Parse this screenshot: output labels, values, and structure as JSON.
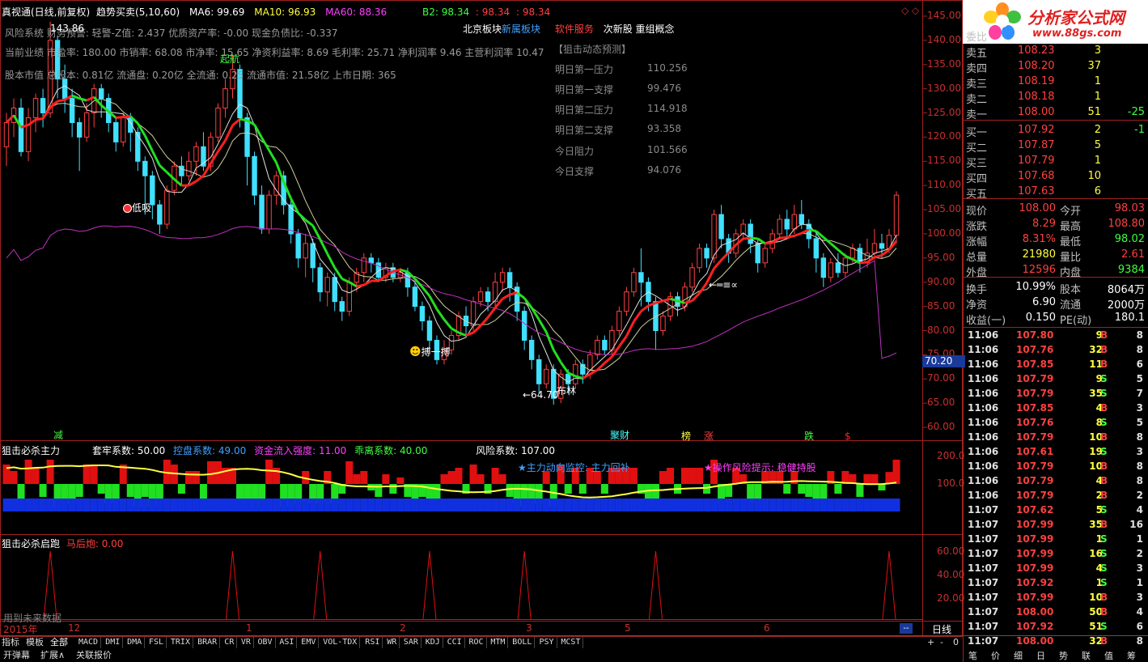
{
  "header": {
    "title": "真视通(日线,前复权)",
    "indicator": "趋势买卖(5,10,60)",
    "ma6_label": "MA6: 99.69",
    "ma10_label": "MA10: 96.93",
    "ma60_label": "MA60: 88.36",
    "b2_label": "B2: 98.34",
    "b2_v2": ": 98.34",
    "b2_v3": ": 98.34",
    "window_icons": "◇ ◇"
  },
  "info_lines": [
    "风险系统 财务预警: 轻警-Z值: 2.437 优质资产率: -0.00 现金负债比: -0.337",
    "当前业绩 市盈率: 180.00 市销率: 68.08 市净率: 15.65 净资利益率: 8.69 毛利率: 25.71 净利润率 9.46 主营利润率 10.47",
    "股本市值 总股本: 0.81亿 流通盘: 0.20亿 全流通: 0.25 流通市值: 21.58亿 上市日期: 365"
  ],
  "concepts": [
    {
      "text": "北京板块",
      "color": "#ffffff"
    },
    {
      "text": "新属板块",
      "color": "#40a0ff"
    },
    {
      "text": "软件服务",
      "color": "#ff4040"
    },
    {
      "text": "次新股",
      "color": "#ffffff"
    },
    {
      "text": "重组概念",
      "color": "#ffffff"
    }
  ],
  "prediction": {
    "title": "【狙击动态预测】",
    "rows": [
      {
        "label": "明日第一压力",
        "value": "110.256"
      },
      {
        "label": "明日第一支撑",
        "value": "99.476"
      },
      {
        "label": "明日第二压力",
        "value": "114.918"
      },
      {
        "label": "明日第二支撑",
        "value": "93.358"
      },
      {
        "label": "今日阻力",
        "value": "101.566"
      },
      {
        "label": "今日支撑",
        "value": "94.076"
      }
    ]
  },
  "main_annotations": {
    "high_mark": "143.86",
    "low_mark": "←64.70",
    "ma_mark": "←═≡∝",
    "qi_hang": "起航",
    "di_xi": "低吸",
    "bo_yi_bo": "搏一搏",
    "bu_lin": "布林",
    "jian": "减",
    "qi_cai": "聚财",
    "bang": "榜",
    "zhang": "涨",
    "die": "跌",
    "dollar": "$",
    "price_box": "70.20"
  },
  "price_axis": [
    "145.00",
    "140.00",
    "135.00",
    "130.00",
    "125.00",
    "120.00",
    "115.00",
    "110.00",
    "105.00",
    "100.00",
    "95.00",
    "90.00",
    "85.00",
    "80.00",
    "75.00",
    "70.00",
    "65.00",
    "60.00"
  ],
  "sub1": {
    "title": "狙击必杀主力",
    "params": [
      {
        "text": "套牢系数: 50.00",
        "color": "#ffffff"
      },
      {
        "text": "控盘系数: 49.00",
        "color": "#40a0ff"
      },
      {
        "text": "资金流入强度: 11.00",
        "color": "#ff40ff"
      },
      {
        "text": "乖离系数: 40.00",
        "color": "#40ff40"
      },
      {
        "text": "风险系数: 107.00",
        "color": "#ffffff"
      }
    ],
    "monitor": "★主力动向监控: 主力回补",
    "risk_tip": "★操作风险提示: 稳健持股",
    "axis": [
      "200.0",
      "100.0"
    ]
  },
  "sub2": {
    "title": "狙击必杀启跑",
    "param": "马后炮: 0.00",
    "note": "用到未来数据",
    "axis": [
      "60.00",
      "40.00",
      "20.00"
    ]
  },
  "date_axis": {
    "year": "2015年",
    "marks": [
      "12",
      "1",
      "2",
      "3",
      "5",
      "6"
    ],
    "period": "日线"
  },
  "quote_panel": {
    "webi": "委比",
    "sells": [
      {
        "label": "卖五",
        "price": "108.23",
        "vol": "3",
        "chg": ""
      },
      {
        "label": "卖四",
        "price": "108.20",
        "vol": "37",
        "chg": ""
      },
      {
        "label": "卖三",
        "price": "108.19",
        "vol": "1",
        "chg": ""
      },
      {
        "label": "卖二",
        "price": "108.18",
        "vol": "1",
        "chg": ""
      },
      {
        "label": "卖一",
        "price": "108.00",
        "vol": "51",
        "chg": "-25"
      }
    ],
    "buys": [
      {
        "label": "买一",
        "price": "107.92",
        "vol": "2",
        "chg": "-1"
      },
      {
        "label": "买二",
        "price": "107.87",
        "vol": "5",
        "chg": ""
      },
      {
        "label": "买三",
        "price": "107.79",
        "vol": "1",
        "chg": ""
      },
      {
        "label": "买四",
        "price": "107.68",
        "vol": "10",
        "chg": ""
      },
      {
        "label": "买五",
        "price": "107.63",
        "vol": "6",
        "chg": ""
      }
    ],
    "stats": [
      {
        "l1": "现价",
        "v1": "108.00",
        "c1": "#ff4040",
        "l2": "今开",
        "v2": "98.03",
        "c2": "#ff4040"
      },
      {
        "l1": "涨跌",
        "v1": "8.29",
        "c1": "#ff4040",
        "l2": "最高",
        "v2": "108.80",
        "c2": "#ff4040"
      },
      {
        "l1": "涨幅",
        "v1": "8.31%",
        "c1": "#ff4040",
        "l2": "最低",
        "v2": "98.02",
        "c2": "#40ff40"
      },
      {
        "l1": "总量",
        "v1": "21980",
        "c1": "#ffff40",
        "l2": "量比",
        "v2": "2.61",
        "c2": "#ff4040"
      },
      {
        "l1": "外盘",
        "v1": "12596",
        "c1": "#ff4040",
        "l2": "内盘",
        "v2": "9384",
        "c2": "#40ff40"
      }
    ],
    "stats2": [
      {
        "l1": "换手",
        "v1": "10.99%",
        "l2": "股本",
        "v2": "8064万"
      },
      {
        "l1": "净资",
        "v1": "6.90",
        "l2": "流通",
        "v2": "2000万"
      },
      {
        "l1": "收益(一)",
        "v1": "0.150",
        "l2": "PE(动)",
        "v2": "180.1"
      }
    ],
    "ticks": [
      {
        "t": "11:06",
        "p": "107.80",
        "v": "9",
        "s": "B",
        "n": "8"
      },
      {
        "t": "11:06",
        "p": "107.76",
        "v": "32",
        "s": "B",
        "n": "8"
      },
      {
        "t": "11:06",
        "p": "107.85",
        "v": "11",
        "s": "B",
        "n": "6"
      },
      {
        "t": "11:06",
        "p": "107.79",
        "v": "9",
        "s": "S",
        "n": "5"
      },
      {
        "t": "11:06",
        "p": "107.79",
        "v": "35",
        "s": "S",
        "n": "7"
      },
      {
        "t": "11:06",
        "p": "107.85",
        "v": "4",
        "s": "B",
        "n": "3"
      },
      {
        "t": "11:06",
        "p": "107.76",
        "v": "8",
        "s": "S",
        "n": "5"
      },
      {
        "t": "11:06",
        "p": "107.79",
        "v": "10",
        "s": "B",
        "n": "8"
      },
      {
        "t": "11:06",
        "p": "107.61",
        "v": "19",
        "s": "S",
        "n": "3"
      },
      {
        "t": "11:06",
        "p": "107.79",
        "v": "10",
        "s": "B",
        "n": "8"
      },
      {
        "t": "11:06",
        "p": "107.79",
        "v": "4",
        "s": "B",
        "n": "8"
      },
      {
        "t": "11:06",
        "p": "107.79",
        "v": "2",
        "s": "B",
        "n": "2"
      },
      {
        "t": "11:07",
        "p": "107.62",
        "v": "5",
        "s": "S",
        "n": "4"
      },
      {
        "t": "11:07",
        "p": "107.99",
        "v": "35",
        "s": "B",
        "n": "16"
      },
      {
        "t": "11:07",
        "p": "107.99",
        "v": "1",
        "s": "S",
        "n": "1"
      },
      {
        "t": "11:07",
        "p": "107.99",
        "v": "16",
        "s": "S",
        "n": "2"
      },
      {
        "t": "11:07",
        "p": "107.99",
        "v": "4",
        "s": "S",
        "n": "3"
      },
      {
        "t": "11:07",
        "p": "107.92",
        "v": "1",
        "s": "S",
        "n": "1"
      },
      {
        "t": "11:07",
        "p": "107.99",
        "v": "10",
        "s": "B",
        "n": "3"
      },
      {
        "t": "11:07",
        "p": "108.00",
        "v": "50",
        "s": "B",
        "n": "4"
      },
      {
        "t": "11:07",
        "p": "107.92",
        "v": "51",
        "s": "S",
        "n": "6"
      },
      {
        "t": "11:07",
        "p": "108.00",
        "v": "32",
        "s": "B",
        "n": "8"
      }
    ]
  },
  "logo": {
    "text": "分析家公式网",
    "url": "www.88gs.com"
  },
  "bottom_tabs": {
    "left": [
      "指标",
      "模板",
      "全部"
    ],
    "indicators": [
      "MACD",
      "DMI",
      "DMA",
      "FSL",
      "TRIX",
      "BRAR",
      "CR",
      "VR",
      "OBV",
      "ASI",
      "EMV",
      "VOL-TDX",
      "RSI",
      "WR",
      "SAR",
      "KDJ",
      "CCI",
      "ROC",
      "MTM",
      "BOLL",
      "PSY",
      "MCST"
    ],
    "ctrl": [
      "+",
      "-",
      "0"
    ],
    "row2": [
      "开弹幕",
      "扩展∧",
      "关联报价"
    ],
    "right": [
      "笔",
      "价",
      "细",
      "日",
      "势",
      "联",
      "值",
      "筹"
    ]
  },
  "colors": {
    "up": "#ff4040",
    "down": "#40e0ff",
    "ma_up": "#ff2020",
    "ma_down": "#20e020",
    "ma60": "#c030c0"
  },
  "chart_data": {
    "type": "candlestick",
    "ylim": [
      58,
      146
    ],
    "candles": [
      [
        118,
        123,
        114,
        125
      ],
      [
        123,
        126,
        120,
        128
      ],
      [
        126,
        117,
        116,
        128
      ],
      [
        117,
        124,
        115,
        126
      ],
      [
        124,
        128,
        121,
        129
      ],
      [
        128,
        125,
        122,
        130
      ],
      [
        125,
        140,
        124,
        143.86
      ],
      [
        140,
        132,
        128,
        141
      ],
      [
        132,
        128,
        125,
        135
      ],
      [
        128,
        123,
        120,
        130
      ],
      [
        123,
        120,
        113,
        124
      ],
      [
        120,
        125,
        119,
        127
      ],
      [
        125,
        130,
        122,
        131
      ],
      [
        130,
        128,
        124,
        131
      ],
      [
        128,
        123,
        121,
        129
      ],
      [
        123,
        119,
        117,
        124
      ],
      [
        119,
        124,
        118,
        125
      ],
      [
        124,
        121,
        117,
        125
      ],
      [
        121,
        115,
        113,
        122
      ],
      [
        115,
        112,
        104,
        116
      ],
      [
        112,
        106,
        103,
        113
      ],
      [
        106,
        102,
        100,
        107
      ],
      [
        102,
        109,
        101,
        110
      ],
      [
        109,
        114,
        108,
        115
      ],
      [
        114,
        112,
        110,
        116
      ],
      [
        112,
        115,
        111,
        117
      ],
      [
        115,
        118,
        112,
        119
      ],
      [
        118,
        114,
        113,
        121
      ],
      [
        114,
        120,
        113,
        121
      ],
      [
        120,
        126,
        119,
        127
      ],
      [
        126,
        130,
        124,
        132
      ],
      [
        130,
        134,
        128,
        137
      ],
      [
        134,
        124,
        122,
        135
      ],
      [
        124,
        116,
        110,
        125
      ],
      [
        116,
        108,
        106,
        117
      ],
      [
        108,
        101,
        100,
        110
      ],
      [
        101,
        108,
        100,
        109
      ],
      [
        108,
        112,
        106,
        113
      ],
      [
        112,
        106,
        104,
        113
      ],
      [
        106,
        100,
        98,
        107
      ],
      [
        100,
        95,
        93,
        101
      ],
      [
        95,
        98,
        91,
        100
      ],
      [
        98,
        93,
        90,
        99
      ],
      [
        93,
        88,
        86,
        94
      ],
      [
        88,
        91,
        85,
        92
      ],
      [
        91,
        86,
        84,
        92
      ],
      [
        86,
        84,
        82,
        87
      ],
      [
        84,
        90,
        83,
        91
      ],
      [
        90,
        92,
        88,
        93
      ],
      [
        92,
        95,
        90,
        96
      ],
      [
        95,
        94,
        92,
        96
      ],
      [
        94,
        91,
        90,
        95
      ],
      [
        91,
        93,
        90,
        94
      ],
      [
        93,
        91,
        90,
        94
      ],
      [
        91,
        92,
        90,
        93
      ],
      [
        92,
        89,
        87,
        93
      ],
      [
        89,
        85,
        84,
        90
      ],
      [
        85,
        82,
        80,
        86
      ],
      [
        82,
        78,
        76,
        83
      ],
      [
        78,
        74,
        73,
        79
      ],
      [
        74,
        76,
        73,
        78
      ],
      [
        76,
        79,
        75,
        80
      ],
      [
        79,
        83,
        78,
        84
      ],
      [
        83,
        81,
        79,
        85
      ],
      [
        81,
        86,
        80,
        87
      ],
      [
        86,
        88,
        85,
        89
      ],
      [
        88,
        86,
        84,
        89
      ],
      [
        86,
        90,
        85,
        92
      ],
      [
        90,
        92,
        88,
        93
      ],
      [
        92,
        89,
        86,
        93
      ],
      [
        89,
        84,
        82,
        90
      ],
      [
        84,
        78,
        76,
        85
      ],
      [
        78,
        74,
        72,
        79
      ],
      [
        74,
        69,
        67,
        75
      ],
      [
        69,
        72,
        68,
        73
      ],
      [
        72,
        66,
        64.7,
        73
      ],
      [
        66,
        71,
        65,
        72
      ],
      [
        71,
        69,
        67,
        72
      ],
      [
        69,
        73,
        68,
        74
      ],
      [
        73,
        71,
        69,
        74
      ],
      [
        71,
        75,
        70,
        76
      ],
      [
        75,
        78,
        74,
        79
      ],
      [
        78,
        76,
        75,
        79
      ],
      [
        76,
        80,
        75,
        81
      ],
      [
        80,
        84,
        79,
        85
      ],
      [
        84,
        88,
        83,
        89
      ],
      [
        88,
        92,
        87,
        93
      ],
      [
        92,
        90,
        85,
        97
      ],
      [
        90,
        86,
        84,
        91
      ],
      [
        86,
        80,
        76,
        87
      ],
      [
        80,
        83,
        79,
        84
      ],
      [
        83,
        87,
        82,
        88
      ],
      [
        87,
        85,
        83,
        88
      ],
      [
        85,
        89,
        84,
        90
      ],
      [
        89,
        93,
        88,
        94
      ],
      [
        93,
        97,
        92,
        98
      ],
      [
        97,
        95,
        93,
        98
      ],
      [
        95,
        104,
        94,
        105
      ],
      [
        104,
        99,
        97,
        106
      ],
      [
        99,
        96,
        94,
        100
      ],
      [
        96,
        100,
        95,
        101
      ],
      [
        100,
        102,
        99,
        103
      ],
      [
        102,
        98,
        96,
        103
      ],
      [
        98,
        94,
        92,
        99
      ],
      [
        94,
        97,
        93,
        98
      ],
      [
        97,
        100,
        96,
        101
      ],
      [
        100,
        103,
        99,
        104
      ],
      [
        103,
        101,
        99,
        105
      ],
      [
        101,
        104,
        100,
        106
      ],
      [
        104,
        102,
        101,
        107
      ],
      [
        102,
        99,
        97,
        103
      ],
      [
        99,
        95,
        92,
        100
      ],
      [
        95,
        91,
        89,
        96
      ],
      [
        91,
        94,
        90,
        95
      ],
      [
        94,
        92,
        91,
        96
      ],
      [
        92,
        95,
        91,
        96
      ],
      [
        95,
        97,
        94,
        98
      ],
      [
        97,
        94,
        92,
        98
      ],
      [
        94,
        96,
        93,
        99
      ],
      [
        96,
        98,
        95,
        101
      ],
      [
        98,
        97,
        95,
        100
      ],
      [
        97,
        99.7,
        96,
        101
      ],
      [
        99.7,
        108,
        98,
        108.8
      ]
    ]
  }
}
